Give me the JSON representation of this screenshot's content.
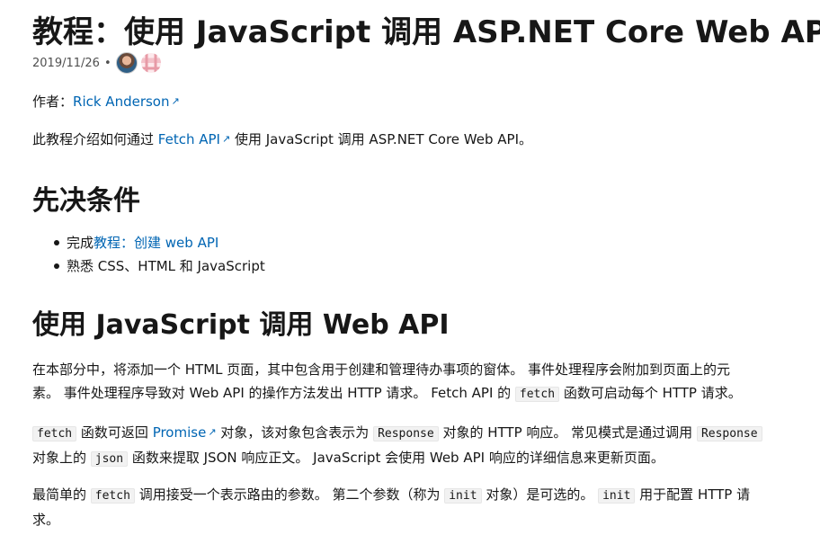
{
  "article": {
    "title": "教程：使用 JavaScript 调用 ASP.NET Core Web API",
    "date": "2019/11/26",
    "author_label": "作者：",
    "author_name": "Rick Anderson",
    "intro_pre": "此教程介绍如何通过 ",
    "intro_link": "Fetch API",
    "intro_post": " 使用 JavaScript 调用 ASP.NET Core Web API。"
  },
  "prereq": {
    "heading": "先决条件",
    "item1_pre": "完成",
    "item1_link": "教程：创建 web API",
    "item2": "熟悉 CSS、HTML 和 JavaScript"
  },
  "call_section": {
    "heading": "使用 JavaScript 调用 Web API",
    "p1_a": "在本部分中，将添加一个 HTML 页面，其中包含用于创建和管理待办事项的窗体。 事件处理程序会附加到页面上的元",
    "p1_b": "素。 事件处理程序导致对 Web API 的操作方法发出 HTTP 请求。 Fetch API 的 ",
    "p1_code": "fetch",
    "p1_c": " 函数可启动每个 HTTP 请求。",
    "p2_code1": "fetch",
    "p2_a": " 函数可返回 ",
    "p2_link": "Promise",
    "p2_b": " 对象，该对象包含表示为 ",
    "p2_code2": "Response",
    "p2_c": " 对象的 HTTP 响应。 常见模式是通过调用 ",
    "p2_code3": "Response",
    "p2_d": "对象上的 ",
    "p2_code4": "json",
    "p2_e": " 函数来提取 JSON 响应正文。 JavaScript 会使用 Web API 响应的详细信息来更新页面。",
    "p3_a": "最简单的 ",
    "p3_code1": "fetch",
    "p3_b": " 调用接受一个表示路由的参数。 第二个参数（称为 ",
    "p3_code2": "init",
    "p3_c": " 对象）是可选的。 ",
    "p3_code3": "init",
    "p3_d": " 用于配置 HTTP 请",
    "p3_e": "求。"
  },
  "icons": {
    "external_link": "↗"
  }
}
